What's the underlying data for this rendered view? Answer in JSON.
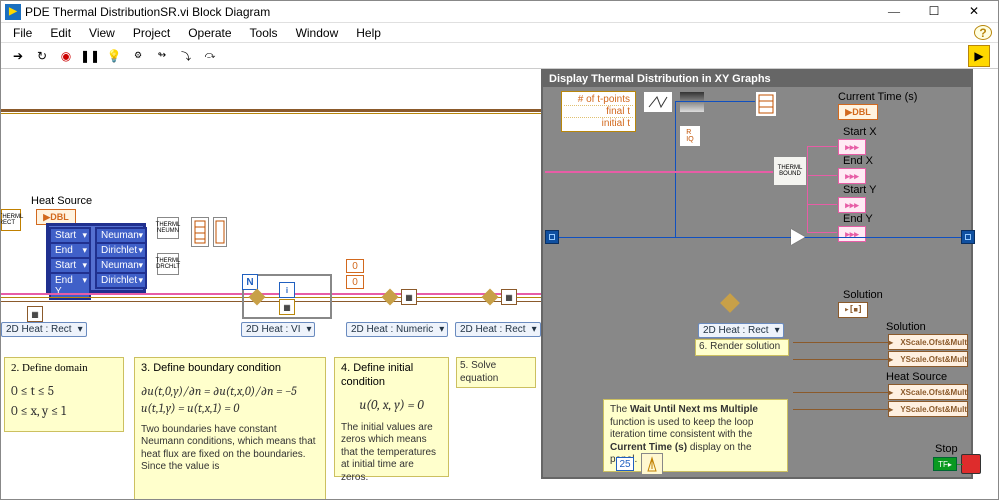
{
  "window": {
    "title": "PDE Thermal DistributionSR.vi Block Diagram"
  },
  "menu": [
    "File",
    "Edit",
    "View",
    "Project",
    "Operate",
    "Tools",
    "Window",
    "Help"
  ],
  "panel": {
    "header": "Display Thermal Distribution in XY Graphs"
  },
  "tpoints_cluster": {
    "rows": [
      "# of t-points",
      "final t",
      "initial t"
    ]
  },
  "current_time_label": "Current Time (s)",
  "dbl_box": "▶DBL",
  "thermal_bounds_icon": "THERML\nBOUND",
  "coords": {
    "start_x": "Start X",
    "end_x": "End X",
    "start_y": "Start Y",
    "end_y": "End Y"
  },
  "heat_source_label": "Heat Source",
  "heat_source_dbl": "▶DBL",
  "bc_group": {
    "rows": [
      {
        "left": "Start X",
        "right": "Neuman"
      },
      {
        "left": "End X",
        "right": "Dirichlet"
      },
      {
        "left": "Start Y",
        "right": "Neuman"
      },
      {
        "left": "End Y",
        "right": "Dirichlet"
      }
    ]
  },
  "bc_icon1": "THERML\nNEUMN",
  "bc_icon2": "THERML\nDRCHLT",
  "zeros": [
    "0",
    "0"
  ],
  "mode_pills": {
    "rect1": "2D Heat : Rect",
    "vi": "2D Heat : VI",
    "num": "2D Heat : Numeric",
    "rect2": "2D Heat : Rect",
    "rect3": "2D Heat : Rect"
  },
  "render_label": "6. Render solution",
  "solution_top_label": "Solution",
  "solution_right": {
    "sol_label": "Solution",
    "sol_x": "XScale.Ofst&Mult",
    "sol_y": "YScale.Ofst&Mult",
    "heat_label": "Heat Source",
    "heat_x": "XScale.Ofst&Mult",
    "heat_y": "YScale.Ofst&Mult"
  },
  "notes": {
    "n2_hdr": "2. Define domain",
    "n2_a": "0 ≤ t ≤ 5",
    "n2_b": "0 ≤ x, y ≤ 1",
    "n3_hdr": "3. Define boundary condition",
    "n3_eq1": "∂u(t,0,y)/∂n = ∂u(t,x,0)/∂n = −5",
    "n3_eq2": "u(t,1,y) = u(t,x,1) = 0",
    "n3_txt": "Two boundaries have constant Neumann conditions, which means that heat flux are fixed on the boundaries. Since the value is",
    "n4_hdr": "4. Define initial condition",
    "n4_eq": "u(0, x, y) = 0",
    "n4_txt": "The initial values are zeros which means that the temperatures at initial time are zeros.",
    "n5_hdr": "5. Solve equation",
    "wait_txt_a": "The ",
    "wait_bold1": "Wait Until Next ms Multiple",
    "wait_txt_b": " function is used to keep the loop iteration time consistent with the ",
    "wait_bold2": "Current Time (s)",
    "wait_txt_c": " display on the panel."
  },
  "const25": "25",
  "r_iq": "R\nIQ",
  "stop_label": "Stop",
  "n_char": "N"
}
